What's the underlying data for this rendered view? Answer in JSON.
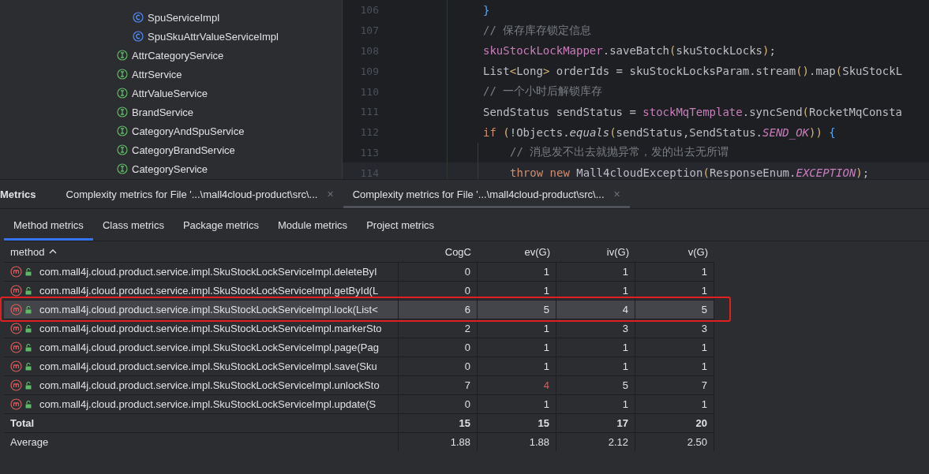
{
  "project_tree": [
    {
      "children": [
        {
          "label": "SpuServiceImpl",
          "kind": "class"
        },
        {
          "label": "SpuSkuAttrValueServiceImpl",
          "kind": "class"
        }
      ]
    },
    {
      "label": "AttrCategoryService",
      "kind": "interface"
    },
    {
      "label": "AttrService",
      "kind": "interface"
    },
    {
      "label": "AttrValueService",
      "kind": "interface"
    },
    {
      "label": "BrandService",
      "kind": "interface"
    },
    {
      "label": "CategoryAndSpuService",
      "kind": "interface"
    },
    {
      "label": "CategoryBrandService",
      "kind": "interface"
    },
    {
      "label": "CategoryService",
      "kind": "interface"
    }
  ],
  "editor": {
    "lines": [
      {
        "number": "106",
        "nested": false,
        "current": false,
        "tokens": [
          {
            "text": "}",
            "kind": "brace"
          }
        ]
      },
      {
        "number": "107",
        "nested": false,
        "current": false,
        "tokens": [
          {
            "text": "// 保存库存锁定信息",
            "kind": "comment"
          }
        ]
      },
      {
        "number": "108",
        "nested": false,
        "current": false,
        "tokens": [
          {
            "text": "skuStockLockMapper",
            "kind": "field"
          },
          {
            "text": ".saveBatch",
            "kind": "plain"
          },
          {
            "text": "(",
            "kind": "paren"
          },
          {
            "text": "skuStockLocks",
            "kind": "plain"
          },
          {
            "text": ")",
            "kind": "paren"
          },
          {
            "text": ";",
            "kind": "plain"
          }
        ]
      },
      {
        "number": "109",
        "nested": false,
        "current": false,
        "tokens": [
          {
            "text": "List",
            "kind": "plain"
          },
          {
            "text": "<",
            "kind": "paren"
          },
          {
            "text": "Long",
            "kind": "plain"
          },
          {
            "text": ">",
            "kind": "paren"
          },
          {
            "text": " orderIds = skuStockLocksParam.stream",
            "kind": "plain"
          },
          {
            "text": "()",
            "kind": "paren"
          },
          {
            "text": ".map",
            "kind": "plain"
          },
          {
            "text": "(",
            "kind": "paren"
          },
          {
            "text": "SkuStockL",
            "kind": "plain"
          }
        ]
      },
      {
        "number": "110",
        "nested": false,
        "current": false,
        "tokens": [
          {
            "text": "// 一个小时后解锁库存",
            "kind": "comment"
          }
        ]
      },
      {
        "number": "111",
        "nested": false,
        "current": false,
        "tokens": [
          {
            "text": "SendStatus sendStatus = ",
            "kind": "plain"
          },
          {
            "text": "stockMqTemplate",
            "kind": "field"
          },
          {
            "text": ".syncSend",
            "kind": "plain"
          },
          {
            "text": "(",
            "kind": "paren"
          },
          {
            "text": "RocketMqConsta",
            "kind": "plain"
          }
        ]
      },
      {
        "number": "112",
        "nested": false,
        "current": false,
        "tokens": [
          {
            "text": "if ",
            "kind": "keyword"
          },
          {
            "text": "(",
            "kind": "paren"
          },
          {
            "text": "!Objects.",
            "kind": "plain"
          },
          {
            "text": "equals",
            "kind": "italic"
          },
          {
            "text": "(",
            "kind": "paren"
          },
          {
            "text": "sendStatus,SendStatus.",
            "kind": "plain"
          },
          {
            "text": "SEND_OK",
            "kind": "constant"
          },
          {
            "text": "))",
            "kind": "paren"
          },
          {
            "text": " {",
            "kind": "brace"
          }
        ]
      },
      {
        "number": "113",
        "nested": true,
        "current": false,
        "tokens": [
          {
            "text": "// 消息发不出去就抛异常，发的出去无所谓",
            "kind": "comment"
          }
        ]
      },
      {
        "number": "114",
        "nested": true,
        "current": true,
        "tokens": [
          {
            "text": "throw new ",
            "kind": "keyword"
          },
          {
            "text": "Mall4cloudException",
            "kind": "plain"
          },
          {
            "text": "(",
            "kind": "paren"
          },
          {
            "text": "ResponseEnum.",
            "kind": "plain"
          },
          {
            "text": "EXCEPTION",
            "kind": "constant"
          },
          {
            "text": ")",
            "kind": "paren"
          },
          {
            "text": ";",
            "kind": "plain"
          }
        ]
      }
    ]
  },
  "tool_window": {
    "title": "Metrics",
    "tabs": [
      {
        "label": "Complexity metrics for File '...\\mall4cloud-product\\src\\...",
        "close": "×",
        "selected": false
      },
      {
        "label": "Complexity metrics for File '...\\mall4cloud-product\\src\\...",
        "close": "×",
        "selected": true
      }
    ],
    "subtabs": [
      {
        "label": "Method metrics",
        "selected": true
      },
      {
        "label": "Class metrics",
        "selected": false
      },
      {
        "label": "Package metrics",
        "selected": false
      },
      {
        "label": "Module metrics",
        "selected": false
      },
      {
        "label": "Project metrics",
        "selected": false
      }
    ],
    "table": {
      "columns": [
        {
          "label": "method",
          "sorted": true
        },
        {
          "label": "CogC",
          "sorted": false
        },
        {
          "label": "ev(G)",
          "sorted": false
        },
        {
          "label": "iv(G)",
          "sorted": false
        },
        {
          "label": "v(G)",
          "sorted": false
        }
      ],
      "rows": [
        {
          "method": "com.mall4j.cloud.product.service.impl.SkuStockLockServiceImpl.deleteByI",
          "selected": false,
          "values": [
            {
              "text": "0",
              "exceeded": false
            },
            {
              "text": "1",
              "exceeded": false
            },
            {
              "text": "1",
              "exceeded": false
            },
            {
              "text": "1",
              "exceeded": false
            }
          ]
        },
        {
          "method": "com.mall4j.cloud.product.service.impl.SkuStockLockServiceImpl.getById(L",
          "selected": false,
          "values": [
            {
              "text": "0",
              "exceeded": false
            },
            {
              "text": "1",
              "exceeded": false
            },
            {
              "text": "1",
              "exceeded": false
            },
            {
              "text": "1",
              "exceeded": false
            }
          ]
        },
        {
          "method": "com.mall4j.cloud.product.service.impl.SkuStockLockServiceImpl.lock(List<",
          "selected": true,
          "values": [
            {
              "text": "6",
              "exceeded": false
            },
            {
              "text": "5",
              "exceeded": false
            },
            {
              "text": "4",
              "exceeded": false
            },
            {
              "text": "5",
              "exceeded": false
            }
          ]
        },
        {
          "method": "com.mall4j.cloud.product.service.impl.SkuStockLockServiceImpl.markerSto",
          "selected": false,
          "values": [
            {
              "text": "2",
              "exceeded": false
            },
            {
              "text": "1",
              "exceeded": false
            },
            {
              "text": "3",
              "exceeded": false
            },
            {
              "text": "3",
              "exceeded": false
            }
          ]
        },
        {
          "method": "com.mall4j.cloud.product.service.impl.SkuStockLockServiceImpl.page(Pag",
          "selected": false,
          "values": [
            {
              "text": "0",
              "exceeded": false
            },
            {
              "text": "1",
              "exceeded": false
            },
            {
              "text": "1",
              "exceeded": false
            },
            {
              "text": "1",
              "exceeded": false
            }
          ]
        },
        {
          "method": "com.mall4j.cloud.product.service.impl.SkuStockLockServiceImpl.save(Sku",
          "selected": false,
          "values": [
            {
              "text": "0",
              "exceeded": false
            },
            {
              "text": "1",
              "exceeded": false
            },
            {
              "text": "1",
              "exceeded": false
            },
            {
              "text": "1",
              "exceeded": false
            }
          ]
        },
        {
          "method": "com.mall4j.cloud.product.service.impl.SkuStockLockServiceImpl.unlockSto",
          "selected": false,
          "values": [
            {
              "text": "7",
              "exceeded": false
            },
            {
              "text": "4",
              "exceeded": true
            },
            {
              "text": "5",
              "exceeded": false
            },
            {
              "text": "7",
              "exceeded": false
            }
          ]
        },
        {
          "method": "com.mall4j.cloud.product.service.impl.SkuStockLockServiceImpl.update(S",
          "selected": false,
          "values": [
            {
              "text": "0",
              "exceeded": false
            },
            {
              "text": "1",
              "exceeded": false
            },
            {
              "text": "1",
              "exceeded": false
            },
            {
              "text": "1",
              "exceeded": false
            }
          ]
        }
      ],
      "summary": [
        {
          "label": "Total",
          "kind": "total",
          "values": [
            "15",
            "15",
            "17",
            "20"
          ]
        },
        {
          "label": "Average",
          "kind": "average",
          "values": [
            "1.88",
            "1.88",
            "2.12",
            "2.50"
          ]
        }
      ]
    }
  }
}
